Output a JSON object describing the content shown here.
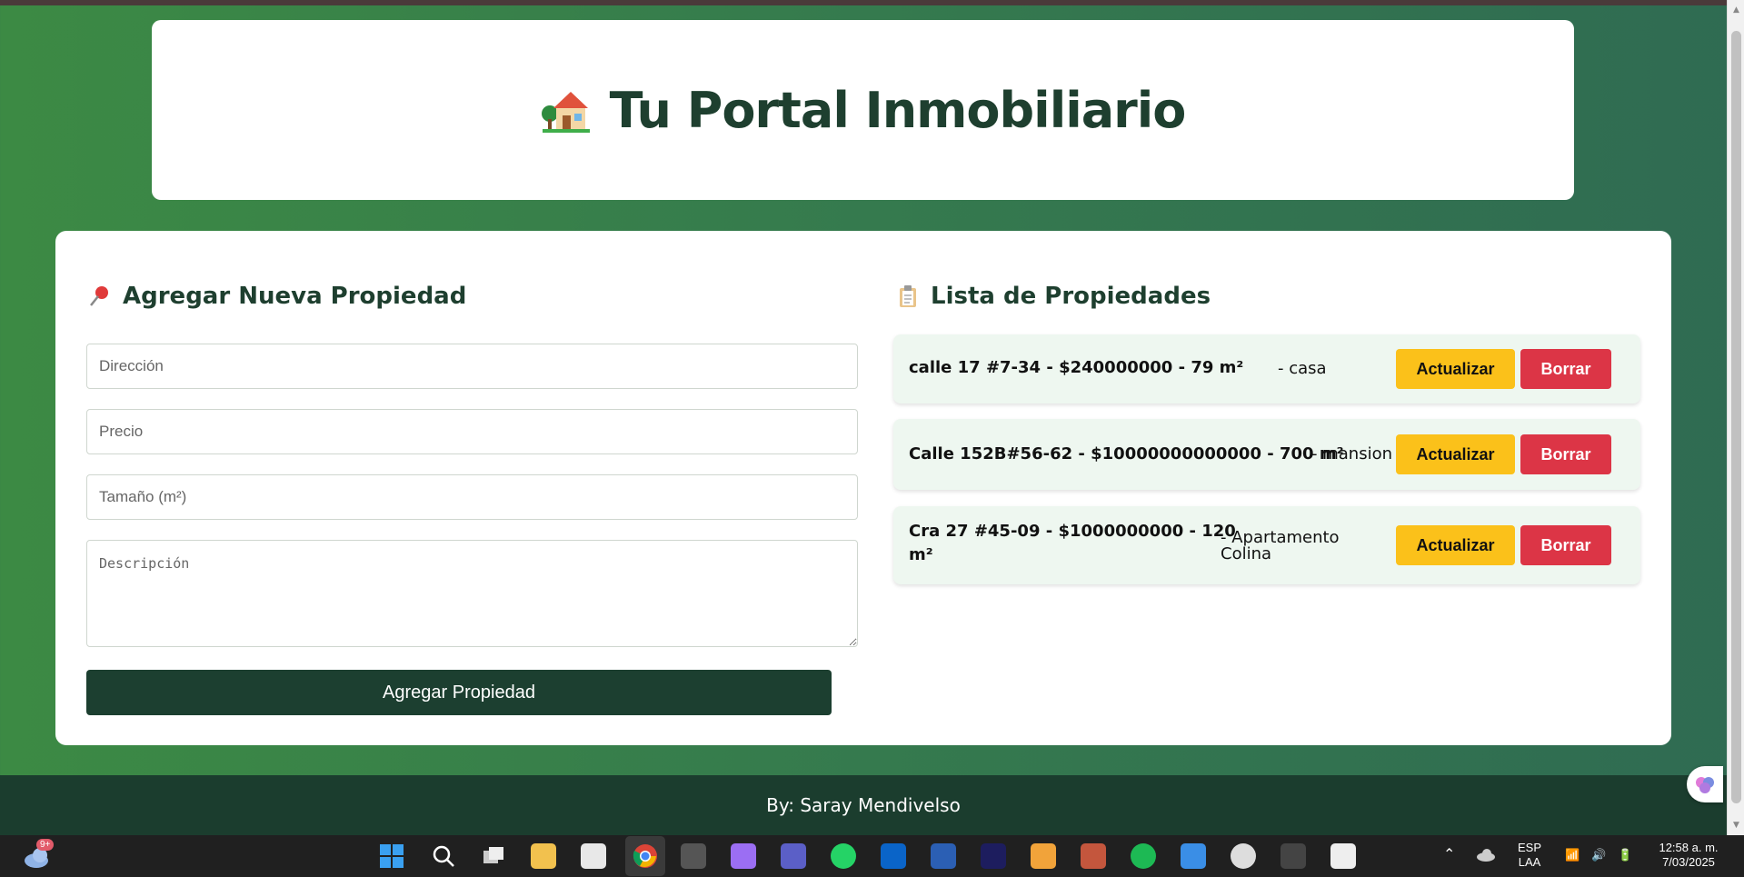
{
  "header": {
    "title": "Tu Portal Inmobiliario",
    "icon": "house-icon"
  },
  "form": {
    "title": "Agregar Nueva Propiedad",
    "icon": "pushpin-icon",
    "direccion_placeholder": "Dirección",
    "precio_placeholder": "Precio",
    "tamano_placeholder": "Tamaño (m²)",
    "descripcion_placeholder": "Descripción",
    "submit_label": "Agregar Propiedad"
  },
  "list": {
    "title": "Lista de Propiedades",
    "icon": "clipboard-icon",
    "items": [
      {
        "main": "calle 17 #7-34 - $240000000 - 79 m²",
        "type": "- casa",
        "update_label": "Actualizar",
        "delete_label": "Borrar"
      },
      {
        "main": "Calle 152B#56-62 - $10000000000000 - 700 m²",
        "type": "- mansion",
        "update_label": "Actualizar",
        "delete_label": "Borrar"
      },
      {
        "main_line1": "Cra 27 #45-09 - $1000000000 - 120",
        "main_line2": "m²",
        "type_line1": "- Apartamento",
        "type_line2": "Colina",
        "update_label": "Actualizar",
        "delete_label": "Borrar"
      }
    ]
  },
  "footer": {
    "text": "By: Saray Mendivelso"
  },
  "colors": {
    "accent_dark": "#1c3f30",
    "update": "#fbc11a",
    "delete": "#dc3546",
    "item_bg": "#eef7f0"
  },
  "taskbar": {
    "weather_badge": "9+",
    "lang_line1": "ESP",
    "lang_line2": "LAA",
    "time": "12:58 a. m.",
    "date": "7/03/2025"
  }
}
